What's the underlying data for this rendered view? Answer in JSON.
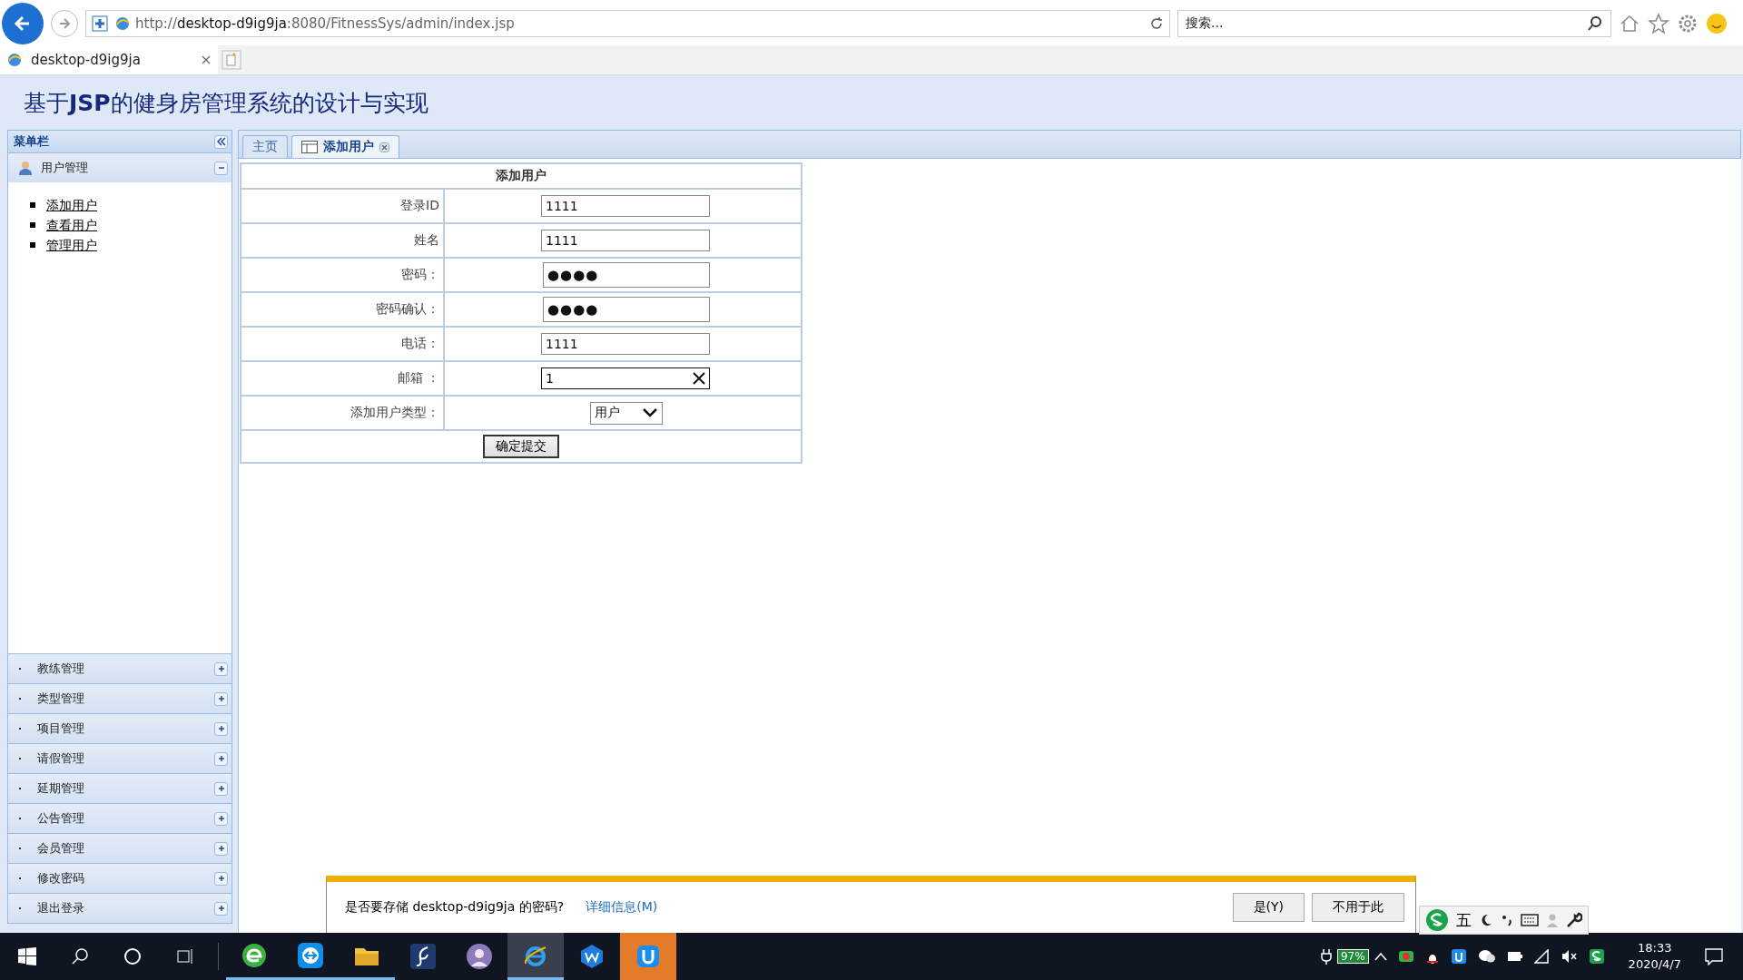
{
  "browser": {
    "url_prefix": "http://",
    "url_host": "desktop-d9ig9ja",
    "url_rest": ":8080/FitnessSys/admin/index.jsp",
    "search_placeholder": "搜索...",
    "tab_title": "desktop-d9ig9ja"
  },
  "header": {
    "title_parts": [
      "基于",
      "JSP",
      "的健身房管理系统的设计与实现"
    ]
  },
  "sidebar": {
    "title": "菜单栏",
    "open_group": {
      "label": "用户管理",
      "expanded": true,
      "links": [
        "添加用户",
        "查看用户",
        "管理用户"
      ]
    },
    "groups": [
      {
        "label": "教练管理",
        "expanded": false
      },
      {
        "label": "类型管理",
        "expanded": false
      },
      {
        "label": "项目管理",
        "expanded": false
      },
      {
        "label": "请假管理",
        "expanded": false
      },
      {
        "label": "延期管理",
        "expanded": false
      },
      {
        "label": "公告管理",
        "expanded": false
      },
      {
        "label": "会员管理",
        "expanded": false
      },
      {
        "label": "修改密码",
        "expanded": false
      },
      {
        "label": "退出登录",
        "expanded": false
      }
    ]
  },
  "tabs": [
    {
      "label": "主页",
      "selected": false,
      "closable": false
    },
    {
      "label": "添加用户",
      "selected": true,
      "closable": true
    }
  ],
  "form": {
    "title": "添加用户",
    "fields": [
      {
        "kind": "text",
        "label": "登录ID",
        "value": "1111"
      },
      {
        "kind": "text",
        "label": "姓名",
        "value": "1111"
      },
      {
        "kind": "password",
        "label": "密码：",
        "value": "●●●●"
      },
      {
        "kind": "password",
        "label": "密码确认：",
        "value": "●●●●"
      },
      {
        "kind": "text",
        "label": "电话：",
        "value": "1111"
      },
      {
        "kind": "focused",
        "label": "邮箱 ：",
        "value": "1"
      },
      {
        "kind": "select",
        "label": "添加用户类型：",
        "value": "用户"
      }
    ],
    "submit": "确定提交"
  },
  "password_prompt": {
    "message": "是否要存储 desktop-d9ig9ja 的密码?",
    "details_link": "详细信息(M)",
    "buttons": [
      "是(Y)",
      "不用于此"
    ]
  },
  "ime": {
    "mode": "五"
  },
  "taskbar": {
    "battery": "97%",
    "time": "18:33",
    "date": "2020/4/7"
  }
}
